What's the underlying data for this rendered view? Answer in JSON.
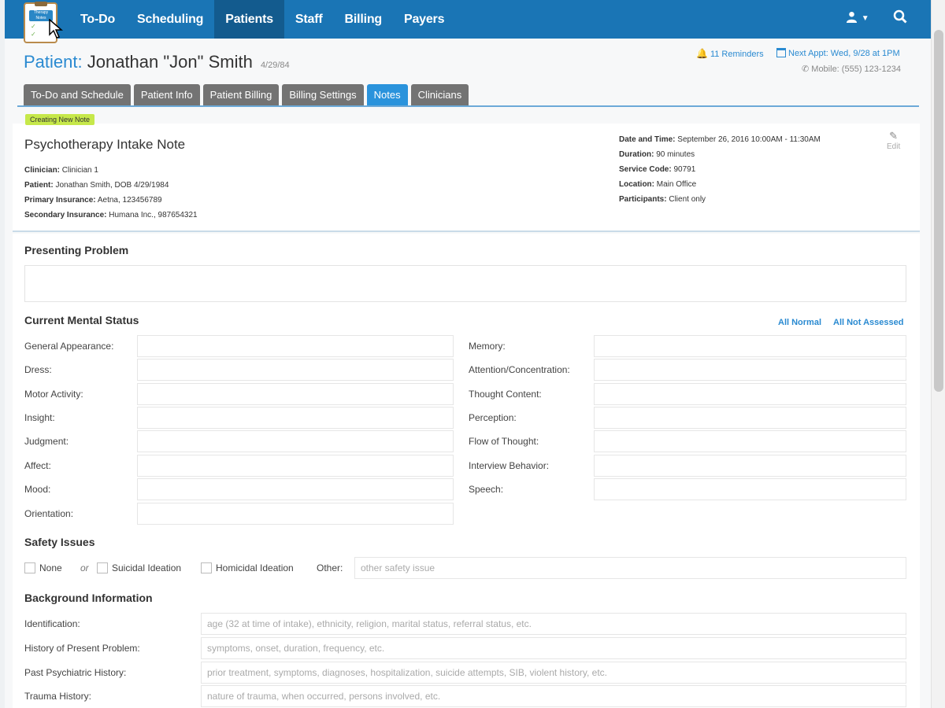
{
  "nav": {
    "logo_text": "Therapy Notes",
    "items": [
      {
        "label": "To-Do"
      },
      {
        "label": "Scheduling"
      },
      {
        "label": "Patients"
      },
      {
        "label": "Staff"
      },
      {
        "label": "Billing"
      },
      {
        "label": "Payers"
      }
    ],
    "active": "Patients",
    "user_icon": "user-icon",
    "search_icon": "search-icon"
  },
  "header": {
    "patient_label": "Patient:",
    "patient_name": "Jonathan \"Jon\" Smith",
    "patient_dob": "4/29/84",
    "reminders": "11 Reminders",
    "next_appt": "Next Appt: Wed, 9/28 at 1PM",
    "mobile": "Mobile: (555) 123-1234"
  },
  "tabs": [
    {
      "label": "To-Do and Schedule"
    },
    {
      "label": "Patient Info"
    },
    {
      "label": "Patient Billing"
    },
    {
      "label": "Billing Settings"
    },
    {
      "label": "Notes"
    },
    {
      "label": "Clinicians"
    }
  ],
  "active_tab": "Notes",
  "note": {
    "badge": "Creating New Note",
    "title": "Psychotherapy Intake Note",
    "clinician_label": "Clinician:",
    "clinician": "Clinician 1",
    "patient_label": "Patient:",
    "patient": "Jonathan Smith, DOB 4/29/1984",
    "primary_label": "Primary Insurance:",
    "primary": "Aetna, 123456789",
    "secondary_label": "Secondary Insurance:",
    "secondary": "Humana Inc., 987654321",
    "datetime_label": "Date and Time:",
    "datetime": "September 26, 2016 10:00AM - 11:30AM",
    "duration_label": "Duration:",
    "duration": "90 minutes",
    "service_label": "Service Code:",
    "service": "90791",
    "location_label": "Location:",
    "location": "Main Office",
    "participants_label": "Participants:",
    "participants": "Client only",
    "edit_label": "Edit"
  },
  "form": {
    "presenting_problem": "Presenting Problem",
    "mental_status": {
      "title": "Current Mental Status",
      "all_normal": "All Normal",
      "all_not_assessed": "All Not Assessed",
      "left": [
        "General Appearance:",
        "Dress:",
        "Motor Activity:",
        "Insight:",
        "Judgment:",
        "Affect:",
        "Mood:",
        "Orientation:"
      ],
      "right": [
        "Memory:",
        "Attention/Concentration:",
        "Thought Content:",
        "Perception:",
        "Flow of Thought:",
        "Interview Behavior:",
        "Speech:"
      ]
    },
    "safety": {
      "title": "Safety Issues",
      "none": "None",
      "or": "or",
      "suicidal": "Suicidal Ideation",
      "homicidal": "Homicidal Ideation",
      "other": "Other:",
      "other_placeholder": "other safety issue"
    },
    "background": {
      "title": "Background Information",
      "rows": [
        {
          "label": "Identification:",
          "placeholder": "age (32 at time of intake), ethnicity, religion, marital status, referral status, etc."
        },
        {
          "label": "History of Present Problem:",
          "placeholder": "symptoms, onset, duration, frequency, etc."
        },
        {
          "label": "Past Psychiatric History:",
          "placeholder": "prior treatment, symptoms, diagnoses, hospitalization, suicide attempts, SIB, violent history, etc."
        },
        {
          "label": "Trauma History:",
          "placeholder": "nature of trauma, when occurred, persons involved, etc."
        }
      ]
    }
  }
}
